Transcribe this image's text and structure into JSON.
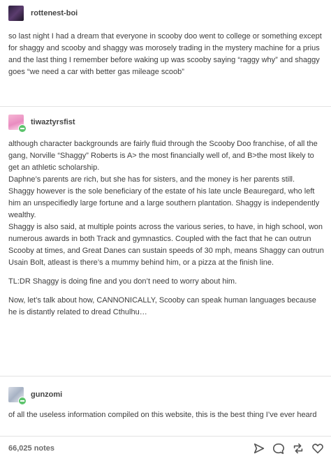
{
  "post1": {
    "username": "rottenest-boi",
    "body": [
      "so last night I had a dream that everyone in scooby doo went to college or something except for shaggy and scooby and shaggy was morosely trading in the mystery machine for a prius and the last thing I remember before waking up was scooby saying “raggy why” and shaggy goes “we need a car with better gas mileage scoob”"
    ]
  },
  "post2": {
    "username": "tiwaztyrsfist",
    "paragraphs": [
      "although character backgrounds are fairly fluid through the Scooby Doo franchise, of all the gang, Norville “Shaggy” Roberts is A> the most financially well of, and B>the most likely to get an athletic scholarship.",
      "Daphne’s parents are rich, but she has for sisters, and the money is her parents still.",
      "Shaggy however is the sole beneficiary of the estate of his late uncle Beauregard, who left him an unspecifiedly large fortune and a large southern plantation. Shaggy is independently wealthy.",
      "Shaggy is also said, at multiple points across the various series, to have, in high school, won numerous awards in both Track and gymnastics. Coupled with the fact that he can outrun Scooby at times, and Great Danes can sustain speeds of 30 mph, means Shaggy can outrun Usain Bolt, atleast is there’s a mummy behind him, or a pizza at the finish line.",
      "TL:DR Shaggy is doing fine and you don’t need to worry about him.",
      "Now, let’s talk about how, CANNONICALLY, Scooby can speak human languages because he is distantly related to dread Cthulhu…"
    ]
  },
  "post3": {
    "username": "gunzomi",
    "body": "of all the useless information compiled on this website, this is the best thing I’ve ever heard"
  },
  "footer": {
    "notes": "66,025 notes"
  },
  "colors": {
    "reblog_green": "#5cc36c",
    "text": "#3c3c3c",
    "divider": "#e3e3e3"
  }
}
